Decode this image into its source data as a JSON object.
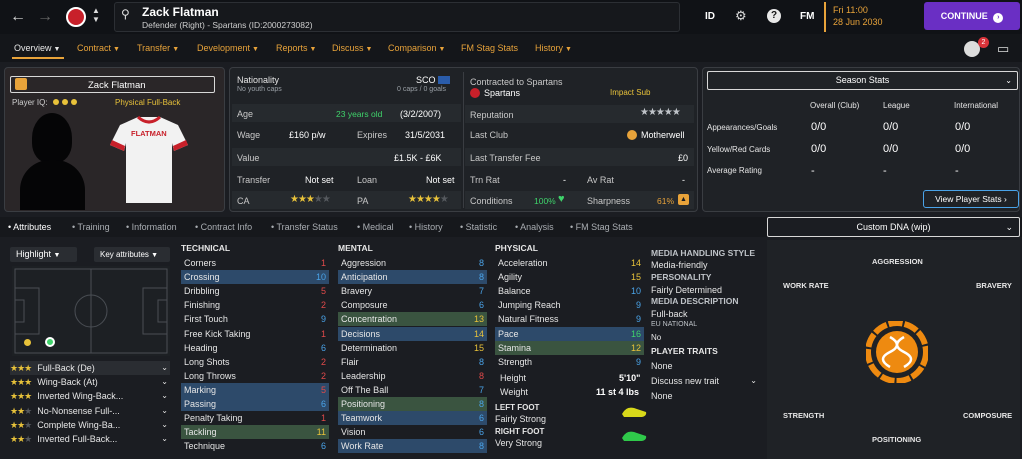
{
  "topbar": {
    "player_name": "Zack Flatman",
    "player_sub": "Defender (Right) - Spartans (ID:2000273082)",
    "id_label": "ID",
    "fm_label": "FM",
    "date_line1": "Fri 11:00",
    "date_line2": "28 Jun 2030",
    "continue": "CONTINUE",
    "notif_count": "2"
  },
  "nav": [
    "Overview",
    "Contract",
    "Transfer",
    "Development",
    "Reports",
    "Discuss",
    "Comparison",
    "FM Stag Stats",
    "History"
  ],
  "card": {
    "name": "Zack Flatman",
    "player_iq_label": "Player IQ:",
    "role_hint": "Physical Full-Back",
    "shirt_name": "FLATMAN"
  },
  "info": {
    "nationality_label": "Nationality",
    "nationality_sub": "No youth caps",
    "nation_code": "SCO",
    "nation_caps": "0 caps / 0 goals",
    "age_label": "Age",
    "age_value": "23 years old",
    "age_dob": "(3/2/2007)",
    "wage_label": "Wage",
    "wage_value": "£160 p/w",
    "expires_label": "Expires",
    "expires_value": "31/5/2031",
    "value_label": "Value",
    "value_value": "£1.5K - £6K",
    "transfer_label": "Transfer",
    "transfer_value": "Not set",
    "loan_label": "Loan",
    "loan_value": "Not set",
    "ca_label": "CA",
    "pa_label": "PA",
    "contracted_label": "Contracted to Spartans",
    "club": "Spartans",
    "squad_status": "Impact Sub",
    "reputation_label": "Reputation",
    "lastclub_label": "Last Club",
    "lastclub_value": "Motherwell",
    "lastfee_label": "Last Transfer Fee",
    "lastfee_value": "£0",
    "trnrat_label": "Trn Rat",
    "trnrat_value": "-",
    "avrat_label": "Av Rat",
    "avrat_value": "-",
    "conditions_label": "Conditions",
    "conditions_value": "100%",
    "sharpness_label": "Sharpness",
    "sharpness_value": "61%"
  },
  "season": {
    "title": "Season Stats",
    "cols": [
      "Overall (Club)",
      "League",
      "International"
    ],
    "rows": [
      {
        "label": "Appearances/Goals",
        "vals": [
          "0/0",
          "0/0",
          "0/0"
        ]
      },
      {
        "label": "Yellow/Red Cards",
        "vals": [
          "0/0",
          "0/0",
          "0/0"
        ]
      },
      {
        "label": "Average Rating",
        "vals": [
          "-",
          "-",
          "-"
        ]
      }
    ],
    "button": "View Player Stats"
  },
  "subtabs": [
    "Attributes",
    "Training",
    "Information",
    "Contract Info",
    "Transfer Status",
    "Medical",
    "History",
    "Statistic",
    "Analysis",
    "FM Stag Stats"
  ],
  "controls": {
    "highlight": "Highlight",
    "key_attributes": "Key attributes"
  },
  "roles": [
    {
      "name": "Full-Back (De)",
      "stars": 2.5
    },
    {
      "name": "Wing-Back (At)",
      "stars": 2.5
    },
    {
      "name": "Inverted Wing-Back...",
      "stars": 2.5
    },
    {
      "name": "No-Nonsense Full-...",
      "stars": 2.0
    },
    {
      "name": "Complete Wing-Ba...",
      "stars": 2.0
    },
    {
      "name": "Inverted Full-Back...",
      "stars": 2.0
    }
  ],
  "technical": {
    "title": "TECHNICAL",
    "attrs": [
      {
        "n": "Corners",
        "v": "1",
        "c": "#e04a4a",
        "h": ""
      },
      {
        "n": "Crossing",
        "v": "10",
        "c": "#4aa3e8",
        "h": "hl"
      },
      {
        "n": "Dribbling",
        "v": "5",
        "c": "#e04a4a",
        "h": ""
      },
      {
        "n": "Finishing",
        "v": "2",
        "c": "#e04a4a",
        "h": ""
      },
      {
        "n": "First Touch",
        "v": "9",
        "c": "#4aa3e8",
        "h": ""
      },
      {
        "n": "Free Kick Taking",
        "v": "1",
        "c": "#e04a4a",
        "h": ""
      },
      {
        "n": "Heading",
        "v": "6",
        "c": "#4aa3e8",
        "h": ""
      },
      {
        "n": "Long Shots",
        "v": "2",
        "c": "#e04a4a",
        "h": ""
      },
      {
        "n": "Long Throws",
        "v": "2",
        "c": "#e04a4a",
        "h": ""
      },
      {
        "n": "Marking",
        "v": "5",
        "c": "#e04a4a",
        "h": "hl"
      },
      {
        "n": "Passing",
        "v": "6",
        "c": "#4aa3e8",
        "h": "hl"
      },
      {
        "n": "Penalty Taking",
        "v": "1",
        "c": "#e04a4a",
        "h": ""
      },
      {
        "n": "Tackling",
        "v": "11",
        "c": "#e8c23a",
        "h": "hlg"
      },
      {
        "n": "Technique",
        "v": "6",
        "c": "#4aa3e8",
        "h": ""
      }
    ]
  },
  "mental": {
    "title": "MENTAL",
    "attrs": [
      {
        "n": "Aggression",
        "v": "8",
        "c": "#4aa3e8",
        "h": ""
      },
      {
        "n": "Anticipation",
        "v": "8",
        "c": "#4aa3e8",
        "h": "hl"
      },
      {
        "n": "Bravery",
        "v": "7",
        "c": "#4aa3e8",
        "h": ""
      },
      {
        "n": "Composure",
        "v": "6",
        "c": "#4aa3e8",
        "h": ""
      },
      {
        "n": "Concentration",
        "v": "13",
        "c": "#e8c23a",
        "h": "hlg"
      },
      {
        "n": "Decisions",
        "v": "14",
        "c": "#e8c23a",
        "h": "hl"
      },
      {
        "n": "Determination",
        "v": "15",
        "c": "#e8c23a",
        "h": ""
      },
      {
        "n": "Flair",
        "v": "8",
        "c": "#4aa3e8",
        "h": ""
      },
      {
        "n": "Leadership",
        "v": "8",
        "c": "#e04a4a",
        "h": ""
      },
      {
        "n": "Off The Ball",
        "v": "7",
        "c": "#4aa3e8",
        "h": ""
      },
      {
        "n": "Positioning",
        "v": "8",
        "c": "#4aa3e8",
        "h": "hlg"
      },
      {
        "n": "Teamwork",
        "v": "6",
        "c": "#4aa3e8",
        "h": "hl"
      },
      {
        "n": "Vision",
        "v": "6",
        "c": "#4aa3e8",
        "h": ""
      },
      {
        "n": "Work Rate",
        "v": "8",
        "c": "#4aa3e8",
        "h": "hl"
      }
    ]
  },
  "physical": {
    "title": "PHYSICAL",
    "attrs": [
      {
        "n": "Acceleration",
        "v": "14",
        "c": "#e8c23a",
        "h": ""
      },
      {
        "n": "Agility",
        "v": "15",
        "c": "#e8c23a",
        "h": ""
      },
      {
        "n": "Balance",
        "v": "10",
        "c": "#4aa3e8",
        "h": ""
      },
      {
        "n": "Jumping Reach",
        "v": "9",
        "c": "#4aa3e8",
        "h": ""
      },
      {
        "n": "Natural Fitness",
        "v": "9",
        "c": "#4aa3e8",
        "h": ""
      },
      {
        "n": "Pace",
        "v": "16",
        "c": "#3fd36b",
        "h": "hl"
      },
      {
        "n": "Stamina",
        "v": "12",
        "c": "#e8c23a",
        "h": "hlg"
      },
      {
        "n": "Strength",
        "v": "9",
        "c": "#4aa3e8",
        "h": ""
      }
    ],
    "height_label": "Height",
    "height_value": "5'10\"",
    "weight_label": "Weight",
    "weight_value": "11 st 4 lbs",
    "left_foot_label": "LEFT FOOT",
    "left_foot_value": "Fairly Strong",
    "right_foot_label": "RIGHT FOOT",
    "right_foot_value": "Very Strong"
  },
  "media": {
    "handling_title": "MEDIA HANDLING STYLE",
    "handling_value": "Media-friendly",
    "personality_title": "PERSONALITY",
    "personality_value": "Fairly Determined",
    "description_title": "MEDIA DESCRIPTION",
    "description_value": "Full-back",
    "eu_title": "EU NATIONAL",
    "eu_value": "No",
    "traits_title": "PLAYER TRAITS",
    "traits_value": "None",
    "discuss_trait": "Discuss new trait",
    "traits_value2": "None"
  },
  "dna": {
    "title": "Custom DNA (wip)",
    "aggression": "AGGRESSION",
    "work_rate": "WORK RATE",
    "bravery": "BRAVERY",
    "strength": "STRENGTH",
    "composure": "COMPOSURE",
    "positioning": "POSITIONING"
  },
  "colors": {
    "accent": "#e8a33a",
    "continue": "#6a2fc4",
    "header_bg": "#101216",
    "panel_bg": "#1f2226"
  }
}
